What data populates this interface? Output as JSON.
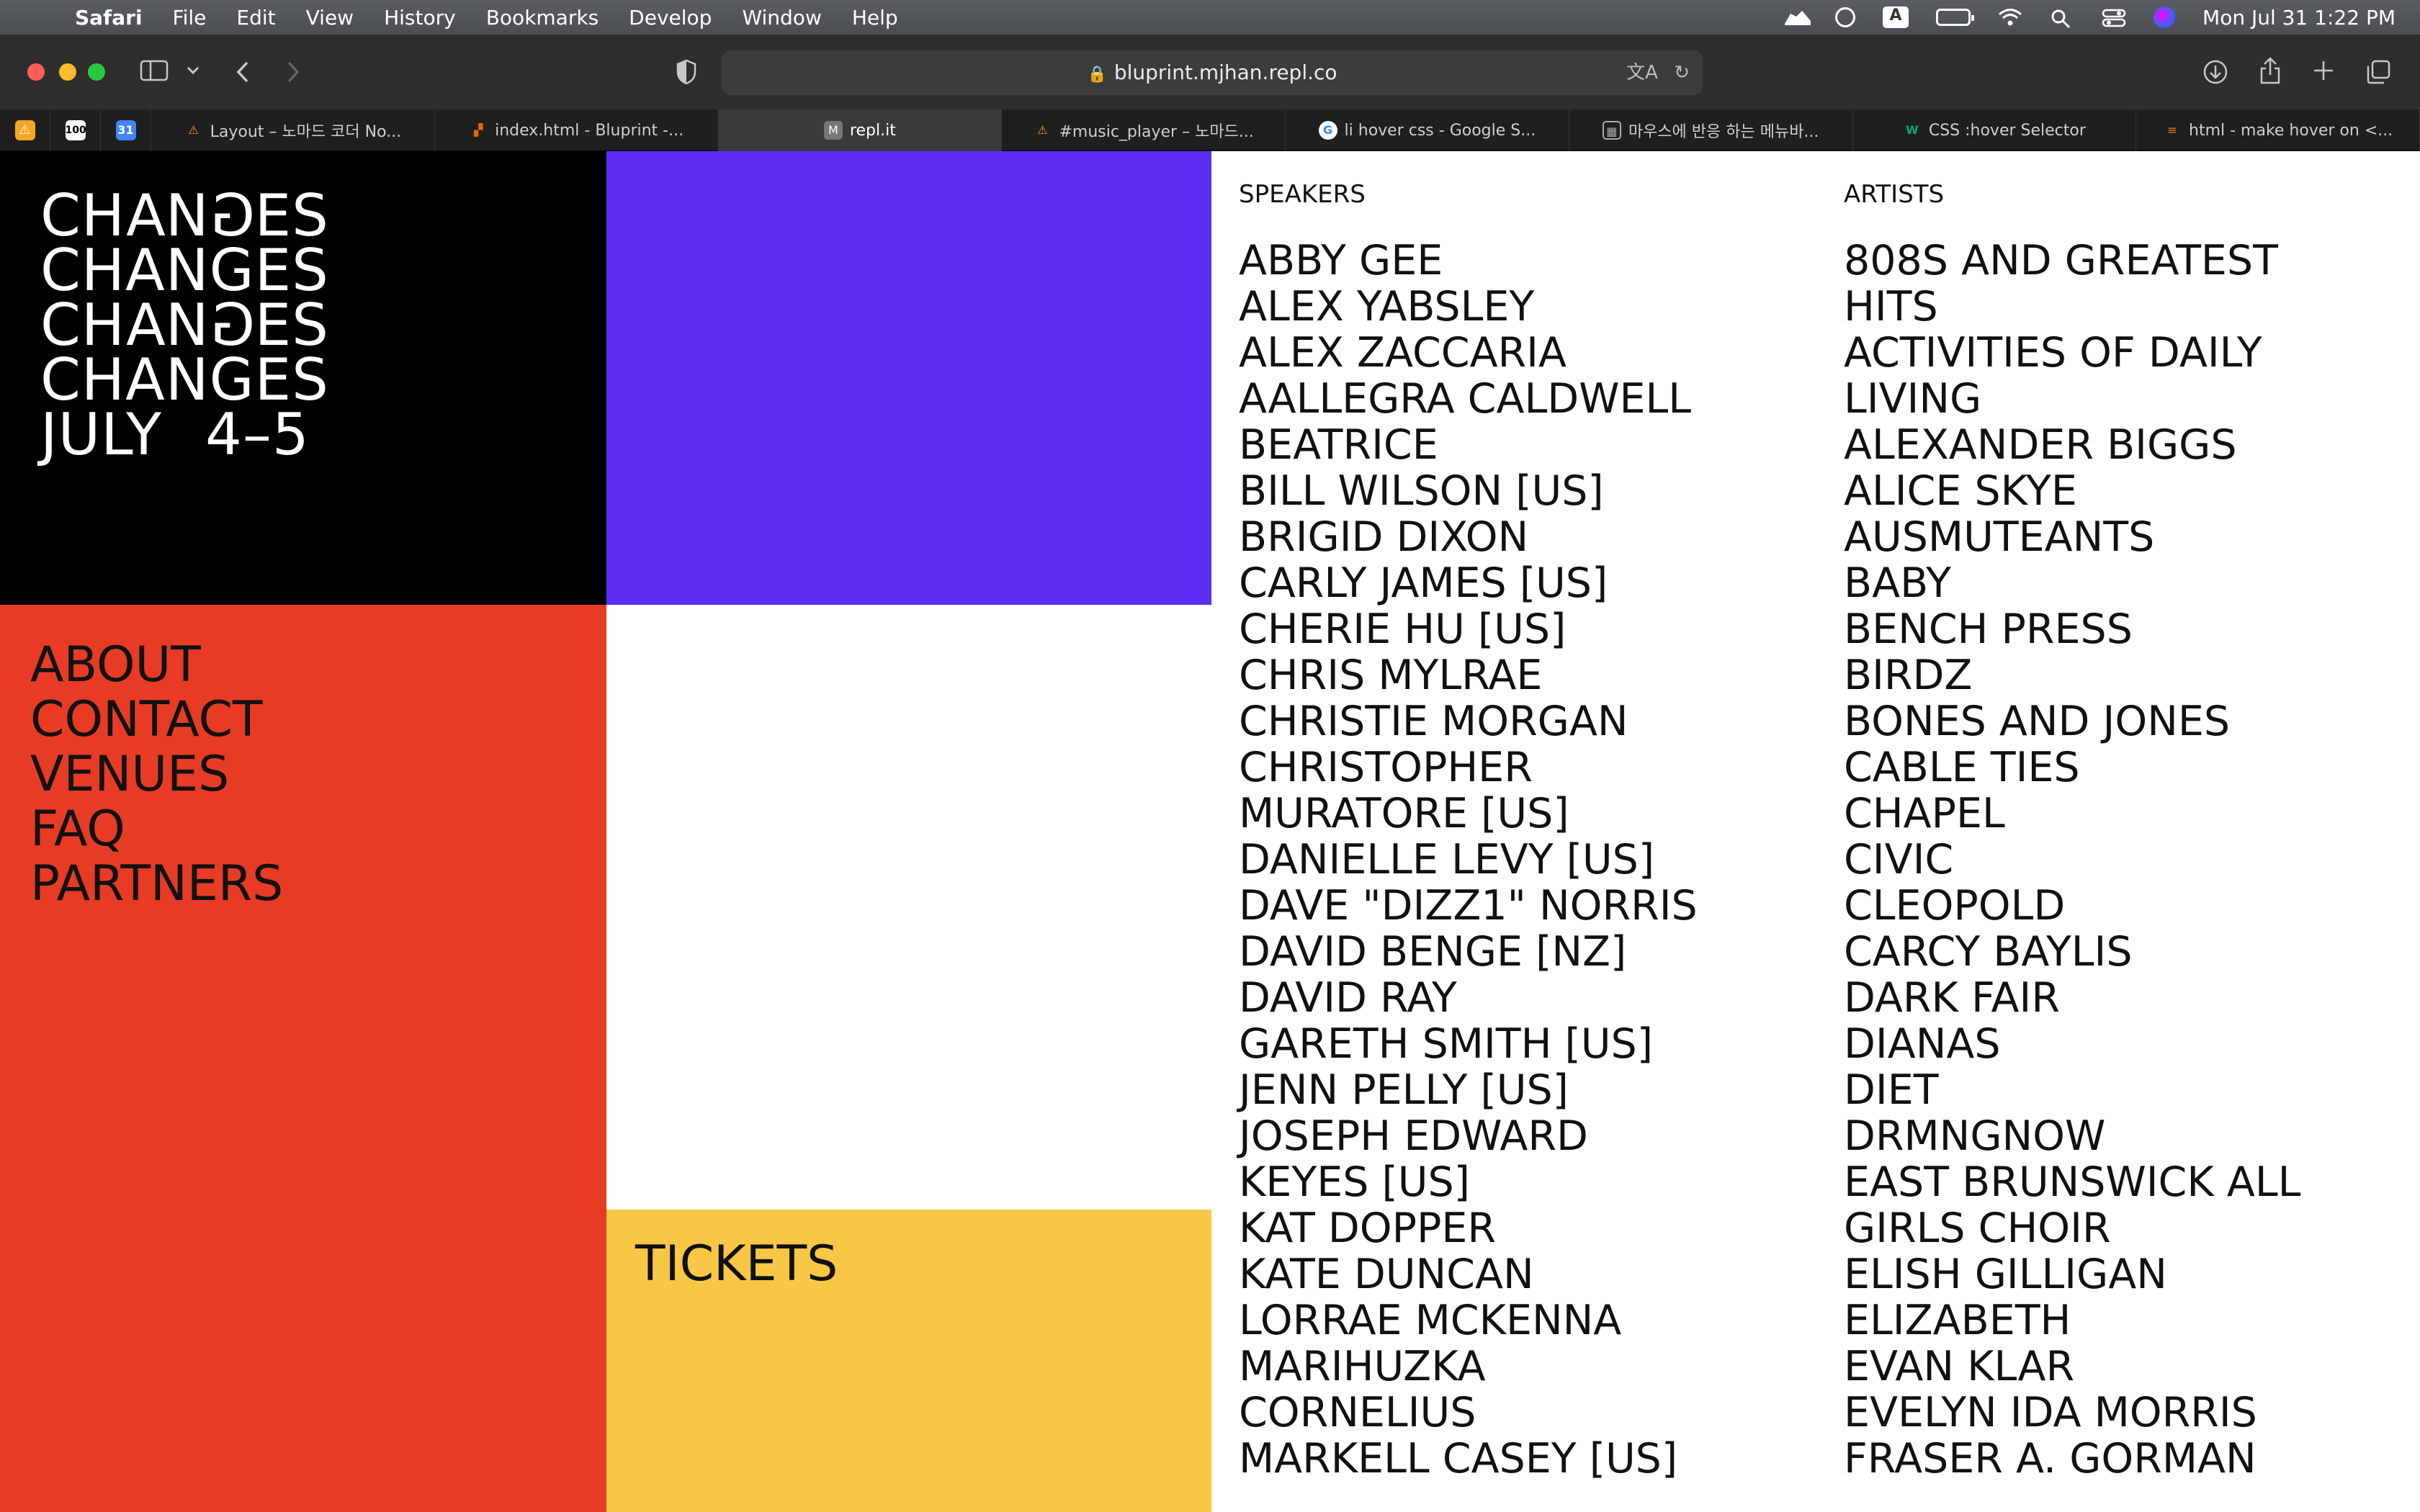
{
  "menubar": {
    "app": "Safari",
    "menus": [
      "File",
      "Edit",
      "View",
      "History",
      "Bookmarks",
      "Develop",
      "Window",
      "Help"
    ],
    "input_badge": "A",
    "datetime": "Mon Jul 31  1:22 PM"
  },
  "toolbar": {
    "url": "bluprint.mjhan.repl.co"
  },
  "tabs": [
    {
      "label": "Layout – 노마드 코더 No...",
      "icon_color": "#f5a623"
    },
    {
      "label": "index.html - Bluprint -...",
      "icon_color": "#f26207"
    },
    {
      "label": "repl.it",
      "icon_color": "#777777",
      "icon_letter": "M"
    },
    {
      "label": "#music_player – 노마드...",
      "icon_color": "#f5a623"
    },
    {
      "label": "li hover css - Google S...",
      "icon_color": "#4285f4"
    },
    {
      "label": "마우스에 반응 하는 메뉴바...",
      "icon_color": "#aaaaaa"
    },
    {
      "label": "CSS :hover Selector",
      "icon_color": "#04aa6d"
    },
    {
      "label": "html - make hover on <...",
      "icon_color": "#f48024"
    }
  ],
  "page": {
    "logo_lines": [
      "CHANGES",
      "CHANGES",
      "CHANGES",
      "CHANGES"
    ],
    "dates": {
      "month": "JULY",
      "days": "4–5"
    },
    "nav": [
      "ABOUT",
      "CONTACT",
      "VENUES",
      "FAQ",
      "PARTNERS"
    ],
    "tickets": "TICKETS",
    "speakers_heading": "SPEAKERS",
    "speakers": [
      "ABBY GEE",
      "ALEX YABSLEY",
      "ALEX ZACCARIA",
      "AALLEGRA CALDWELL",
      "BEATRICE",
      "BILL WILSON [US]",
      "BRIGID DIXON",
      "CARLY JAMES [US]",
      "CHERIE HU [US]",
      "CHRIS MYLRAE",
      "CHRISTIE MORGAN",
      "CHRISTOPHER",
      "MURATORE [US]",
      "DANIELLE LEVY [US]",
      "DAVE \"DIZZ1\" NORRIS",
      "DAVID BENGE [NZ]",
      "DAVID RAY",
      "GARETH SMITH [US]",
      "JENN PELLY [US]",
      "JOSEPH EDWARD",
      "KEYES [US]",
      "KAT DOPPER",
      "KATE DUNCAN",
      "LORRAE MCKENNA",
      "MARIHUZKA",
      "CORNELIUS",
      "MARKELL CASEY [US]"
    ],
    "artists_heading": "ARTISTS",
    "artists": [
      "808S AND GREATEST",
      "HITS",
      "ACTIVITIES OF DAILY",
      "LIVING",
      "ALEXANDER BIGGS",
      "ALICE SKYE",
      "AUSMUTEANTS",
      "BABY",
      "BENCH PRESS",
      "BIRDZ",
      "BONES AND JONES",
      "CABLE TIES",
      "CHAPEL",
      "CIVIC",
      "CLEOPOLD",
      "CARCY BAYLIS",
      "DARK FAIR",
      "DIANAS",
      "DIET",
      "DRMNGNOW",
      "EAST BRUNSWICK ALL",
      "GIRLS CHOIR",
      "ELISH GILLIGAN",
      "ELIZABETH",
      "EVAN KLAR",
      "EVELYN IDA MORRIS",
      "FRASER A. GORMAN"
    ]
  }
}
